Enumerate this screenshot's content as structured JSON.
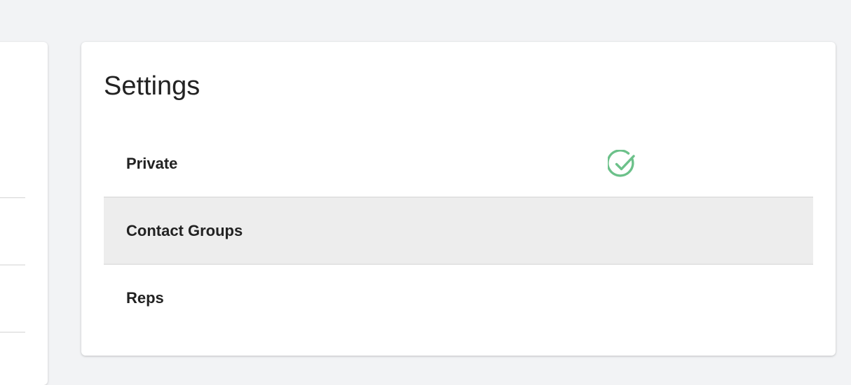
{
  "settings": {
    "title": "Settings",
    "items": [
      {
        "label": "Private",
        "checked": true,
        "highlighted": false
      },
      {
        "label": "Contact Groups",
        "checked": false,
        "highlighted": true
      },
      {
        "label": "Reps",
        "checked": false,
        "highlighted": false
      }
    ]
  },
  "icons": {
    "check": "check-circle-icon"
  },
  "colors": {
    "page_background": "#f2f3f5",
    "card_background": "#ffffff",
    "highlight_row": "#ededed",
    "check_green": "#6cc18a",
    "text": "#222222",
    "divider": "#d4d4d4"
  }
}
